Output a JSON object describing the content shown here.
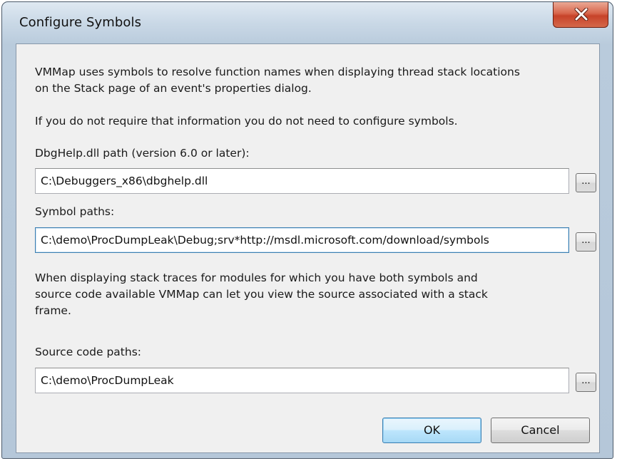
{
  "window": {
    "title": "Configure Symbols"
  },
  "dialog": {
    "intro_line1": "VMMap uses symbols to resolve function names when displaying thread stack locations",
    "intro_line2": "on the Stack page of an event's properties dialog.",
    "intro_note": "If you do not require that information you do not need to configure symbols.",
    "dbghelp": {
      "label": "DbgHelp.dll path (version 6.0 or later):",
      "value": "C:\\Debuggers_x86\\dbghelp.dll",
      "browse_label": "..."
    },
    "symbol_paths": {
      "label": "Symbol paths:",
      "value": "C:\\demo\\ProcDumpLeak\\Debug;srv*http://msdl.microsoft.com/download/symbols",
      "browse_label": "..."
    },
    "source_note_line1": "When displaying stack traces for modules for which you have both symbols and",
    "source_note_line2": "source code available VMMap can let you view the source associated with a stack",
    "source_note_line3": "frame.",
    "source_paths": {
      "label": "Source code paths:",
      "value": "C:\\demo\\ProcDumpLeak",
      "browse_label": "..."
    },
    "ok_label": "OK",
    "cancel_label": "Cancel"
  },
  "icons": {
    "close": "close-icon"
  }
}
